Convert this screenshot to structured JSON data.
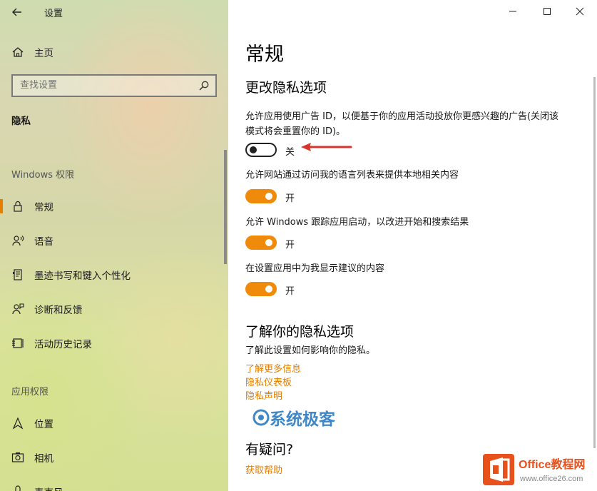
{
  "window": {
    "title": "设置"
  },
  "sidebar": {
    "home_label": "主页",
    "search": {
      "placeholder": "查找设置"
    },
    "current_section": "隐私",
    "windows_group": {
      "header": "Windows 权限",
      "items": [
        {
          "label": "常规",
          "icon": "lock-icon",
          "active": true
        },
        {
          "label": "语音",
          "icon": "speech-icon"
        },
        {
          "label": "墨迹书写和键入个性化",
          "icon": "ink-icon"
        },
        {
          "label": "诊断和反馈",
          "icon": "feedback-icon"
        },
        {
          "label": "活动历史记录",
          "icon": "history-icon"
        }
      ]
    },
    "app_group": {
      "header": "应用权限",
      "items": [
        {
          "label": "位置",
          "icon": "location-icon"
        },
        {
          "label": "相机",
          "icon": "camera-icon"
        },
        {
          "label": "麦克风",
          "icon": "microphone-icon"
        }
      ]
    }
  },
  "main": {
    "page_title": "常规",
    "privacy_heading": "更改隐私选项",
    "options": [
      {
        "text": "允许应用使用广告 ID，以便基于你的应用活动投放你更感兴趣的广告(关闭该模式将会重置你的 ID)。",
        "state": "关",
        "on": false
      },
      {
        "text": "允许网站通过访问我的语言列表来提供本地相关内容",
        "state": "开",
        "on": true
      },
      {
        "text": "允许 Windows 跟踪应用启动，以改进开始和搜索结果",
        "state": "开",
        "on": true
      },
      {
        "text": "在设置应用中为我显示建议的内容",
        "state": "开",
        "on": true
      }
    ],
    "learn": {
      "heading": "了解你的隐私选项",
      "text": "了解此设置如何影响你的隐私。",
      "links": [
        "了解更多信息",
        "隐私仪表板",
        "隐私声明"
      ]
    },
    "question": {
      "heading": "有疑问?",
      "link": "获取帮助"
    }
  },
  "watermarks": {
    "syskc": "系统极客",
    "office_title": "Office教程网",
    "office_url": "www.office26.com"
  },
  "colors": {
    "accent": "#f08a0a",
    "link": "#e67e00",
    "watermark_blue": "#1e73be"
  }
}
